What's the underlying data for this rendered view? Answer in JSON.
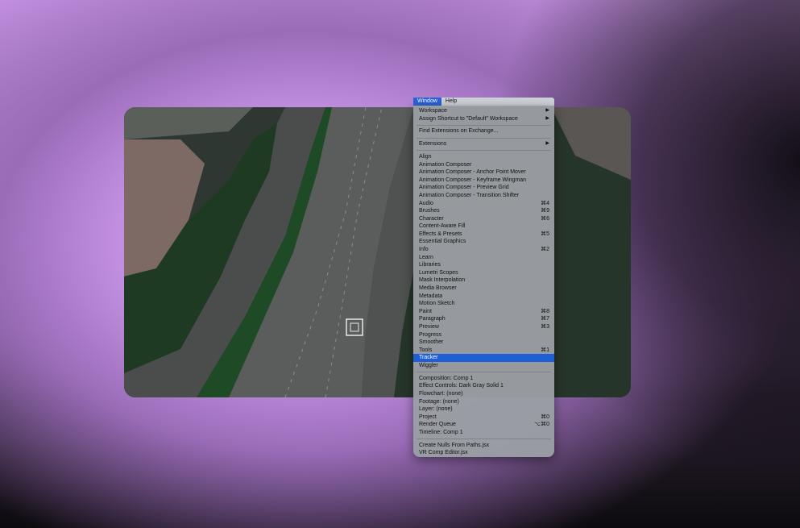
{
  "menubar": {
    "items": [
      {
        "label": "Window",
        "active": true
      },
      {
        "label": "Help",
        "active": false
      }
    ]
  },
  "menu": {
    "group1": [
      {
        "label": "Workspace",
        "submenu": true
      },
      {
        "label": "Assign Shortcut to \"Default\" Workspace",
        "submenu": true
      }
    ],
    "group2": [
      {
        "label": "Find Extensions on Exchange..."
      }
    ],
    "group3": [
      {
        "label": "Extensions",
        "submenu": true
      }
    ],
    "panels": [
      {
        "label": "Align",
        "shortcut": ""
      },
      {
        "label": "Animation Composer",
        "shortcut": ""
      },
      {
        "label": "Animation Composer - Anchor Point Mover",
        "shortcut": ""
      },
      {
        "label": "Animation Composer - Keyframe Wingman",
        "shortcut": ""
      },
      {
        "label": "Animation Composer - Preview Grid",
        "shortcut": ""
      },
      {
        "label": "Animation Composer - Transition Shifter",
        "shortcut": ""
      },
      {
        "label": "Audio",
        "shortcut": "⌘4"
      },
      {
        "label": "Brushes",
        "shortcut": "⌘9"
      },
      {
        "label": "Character",
        "shortcut": "⌘6"
      },
      {
        "label": "Content-Aware Fill",
        "shortcut": ""
      },
      {
        "label": "Effects & Presets",
        "shortcut": "⌘5"
      },
      {
        "label": "Essential Graphics",
        "shortcut": ""
      },
      {
        "label": "Info",
        "shortcut": "⌘2"
      },
      {
        "label": "Learn",
        "shortcut": ""
      },
      {
        "label": "Libraries",
        "shortcut": ""
      },
      {
        "label": "Lumetri Scopes",
        "shortcut": ""
      },
      {
        "label": "Mask Interpolation",
        "shortcut": ""
      },
      {
        "label": "Media Browser",
        "shortcut": ""
      },
      {
        "label": "Metadata",
        "shortcut": ""
      },
      {
        "label": "Motion Sketch",
        "shortcut": ""
      },
      {
        "label": "Paint",
        "shortcut": "⌘8"
      },
      {
        "label": "Paragraph",
        "shortcut": "⌘7"
      },
      {
        "label": "Preview",
        "shortcut": "⌘3"
      },
      {
        "label": "Progress",
        "shortcut": ""
      },
      {
        "label": "Smoother",
        "shortcut": ""
      },
      {
        "label": "Tools",
        "shortcut": "⌘1"
      },
      {
        "label": "Tracker",
        "shortcut": "",
        "selected": true
      },
      {
        "label": "Wiggler",
        "shortcut": ""
      }
    ],
    "viewers": [
      {
        "label": "Composition: Comp 1",
        "shortcut": ""
      },
      {
        "label": "Effect Controls: Dark Gray Solid 1",
        "shortcut": ""
      },
      {
        "label": "Flowchart: (none)",
        "shortcut": ""
      },
      {
        "label": "Footage: (none)",
        "shortcut": ""
      },
      {
        "label": "Layer: (none)",
        "shortcut": ""
      },
      {
        "label": "Project",
        "shortcut": "⌘0"
      },
      {
        "label": "Render Queue",
        "shortcut": "⌥⌘0"
      },
      {
        "label": "Timeline: Comp 1",
        "shortcut": ""
      }
    ],
    "scripts": [
      {
        "label": "Create Nulls From Paths.jsx"
      },
      {
        "label": "VR Comp Editor.jsx"
      }
    ]
  },
  "colors": {
    "selection": "#1f5fd6",
    "menu_bg": "#9a9ea3",
    "background": "#c28fe0"
  },
  "icons": {
    "submenu": "triangle-right-icon"
  }
}
